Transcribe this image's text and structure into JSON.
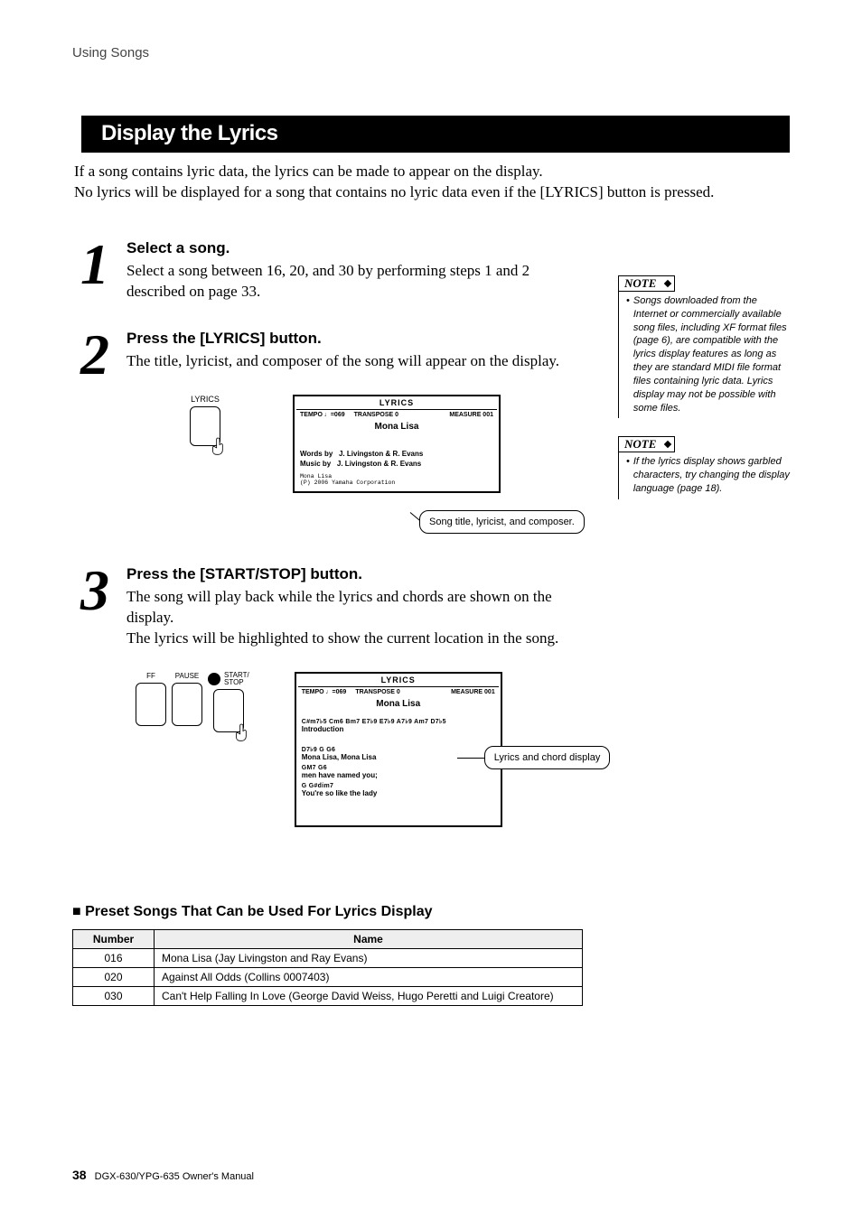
{
  "running_head": "Using Songs",
  "section_title": "Display the Lyrics",
  "intro_line1": "If a song contains lyric data, the lyrics can be made to appear on the display.",
  "intro_line2": "No lyrics will be displayed for a song that contains no lyric data even if the [LYRICS] button is pressed.",
  "steps": {
    "s1": {
      "num": "1",
      "title": "Select a song.",
      "text": "Select a song between 16, 20, and 30 by performing steps 1 and 2 described on page 33."
    },
    "s2": {
      "num": "2",
      "title": "Press the [LYRICS] button.",
      "text": "The title, lyricist, and composer of the song will appear on the display.",
      "panel_label": "LYRICS",
      "lcd": {
        "header": "LYRICS",
        "tempo": "TEMPO ♩=069",
        "transpose": "TRANSPOSE   0",
        "measure": "MEASURE  001",
        "song": "Mona Lisa",
        "words_by_label": "Words by",
        "words_by": "J. Livingston & R. Evans",
        "music_by_label": "Music by",
        "music_by": "J. Livingston & R. Evans",
        "fine1": "Mona Lisa",
        "fine2": "(P) 2006 Yamaha Corporation"
      },
      "callout": "Song title, lyricist, and composer."
    },
    "s3": {
      "num": "3",
      "title": "Press the [START/STOP] button.",
      "text1": "The song will play back while the lyrics and chords are shown on the display.",
      "text2": "The lyrics will be highlighted to show the current location in the song.",
      "panel": {
        "ff": "FF",
        "pause": "PAUSE",
        "start": "START/\nSTOP"
      },
      "lcd": {
        "header": "LYRICS",
        "tempo": "TEMPO ♩=069",
        "transpose": "TRANSPOSE   0",
        "measure": "MEASURE  001",
        "song": "Mona Lisa",
        "chords1": "C#m7♭5     Cm6 Bm7 E7♭9 E7♭9 A7♭9 Am7 D7♭5",
        "lyric1": "Introduction",
        "chords2": "D7♭9   G         G6",
        "lyric2": "Mona Lisa, Mona Lisa",
        "chords3": "        GM7        G6",
        "lyric3": "men have named you;",
        "chords4": "        G          G#dim7",
        "lyric4": "You're so like the lady"
      },
      "callout": "Lyrics and chord display"
    }
  },
  "notes": {
    "label": "NOTE",
    "n1": "Songs downloaded from the Internet or commercially available song files, including XF format files (page 6), are compatible with the lyrics display features as long as they are standard MIDI file format files containing lyric data. Lyrics display may not be possible with some files.",
    "n2": "If the lyrics display shows garbled characters, try changing the display language (page 18)."
  },
  "preset": {
    "heading": "Preset Songs That Can be Used For Lyrics Display",
    "th_number": "Number",
    "th_name": "Name",
    "rows": [
      {
        "num": "016",
        "name": "Mona Lisa (Jay Livingston and Ray Evans)"
      },
      {
        "num": "020",
        "name": "Against All Odds (Collins 0007403)"
      },
      {
        "num": "030",
        "name": "Can't Help Falling In Love (George David Weiss, Hugo Peretti and Luigi Creatore)"
      }
    ]
  },
  "footer": {
    "page": "38",
    "manual": "DGX-630/YPG-635  Owner's Manual"
  }
}
